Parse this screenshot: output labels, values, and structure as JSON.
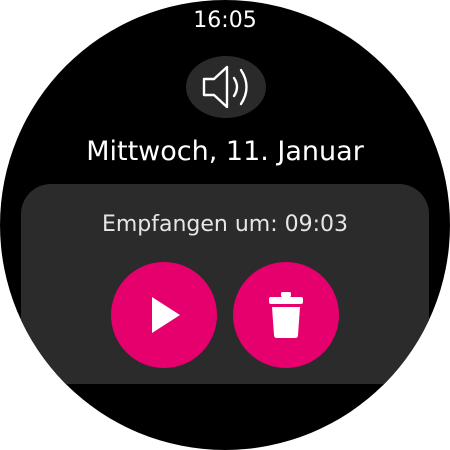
{
  "status": {
    "time": "16:05"
  },
  "header": {
    "speaker_icon": "volume-icon",
    "date": "Mittwoch, 11. Januar"
  },
  "message": {
    "received_label": "Empfangen um: 09:03",
    "play_icon": "play-icon",
    "delete_icon": "trash-icon"
  },
  "colors": {
    "background": "#000000",
    "card": "#2b2b2b",
    "accent": "#e5006e",
    "icon_button": "#2a2a2a"
  }
}
